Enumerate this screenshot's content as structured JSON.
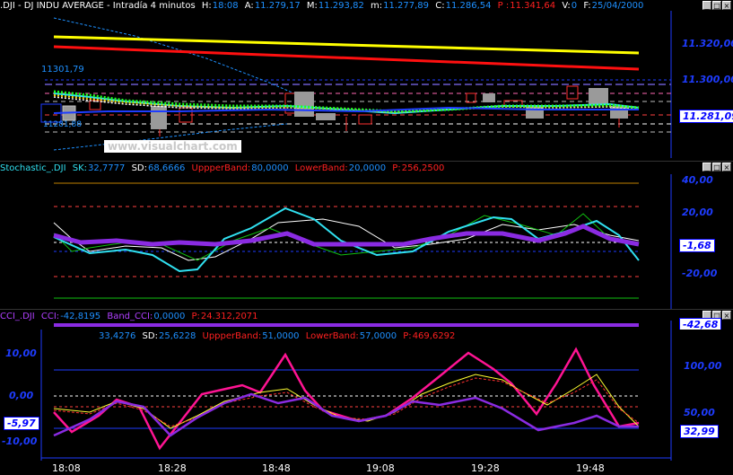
{
  "colors": {
    "axis": "#1e3cff",
    "yellow": "#ffff00",
    "red": "#ff1010",
    "cyan": "#30e0f0",
    "violet": "#8a2be2",
    "magenta": "#ff1493",
    "green": "#10c010",
    "white": "#ffffff",
    "grey": "#9a9a9a"
  },
  "price_pane": {
    "header": {
      "symbol": ".DJI - DJ INDU AVERAGE - Intradía 4 minutos",
      "h_label": "H:",
      "h_value": "18:08",
      "a_label": "A:",
      "a_value": "11.279,17",
      "m_label": "M:",
      "m_value": "11.293,82",
      "min_label": "m:",
      "min_value": "11.277,89",
      "c_label": "C:",
      "c_value": "11.286,54",
      "p_label": "P :",
      "p_value": "11.341,64",
      "v_label": "V:",
      "v_value": "0",
      "f_label": "F:",
      "f_value": "25/04/2000"
    },
    "axis_labels": [
      "11.320,00",
      "11.300,00"
    ],
    "current_value": "11.281,09",
    "level_label_top": "11301,79",
    "level_label_bottom": "11281,88",
    "watermark": "www.visualchart.com"
  },
  "stoch_pane": {
    "header": {
      "name": "Stochastic_.DJI",
      "sk_label": "SK:",
      "sk_value": "32,7777",
      "sd_label": "SD:",
      "sd_value": "68,6666",
      "upper_label": "UppperBand:",
      "upper_value": "80,0000",
      "lower_label": "LowerBand:",
      "lower_value": "20,0000",
      "p_label": "P:",
      "p_value": "256,2500"
    },
    "axis_labels": [
      "40,00",
      "20,00",
      "-20,00"
    ],
    "current_value": "-1,68"
  },
  "cci_pane": {
    "header": {
      "name": "CCI_.DJI",
      "cci_label": "CCI:",
      "cci_value": "-42,8195",
      "band_label": "Band_CCI:",
      "band_value": "0,0000",
      "p_label": "P:",
      "p_value": "24.312,2071"
    },
    "current_value": "-42,68"
  },
  "stoch2_pane": {
    "header": {
      "sk_value": "33,4276",
      "sd_label": "SD:",
      "sd_value": "25,6228",
      "upper_label": "UppperBand:",
      "upper_value": "51,0000",
      "lower_label": "LowerBand:",
      "lower_value": "57,0000",
      "p_label": "P:",
      "p_value": "469,6292"
    },
    "left_axis_labels": [
      "10,00",
      "0,00",
      "-10,00"
    ],
    "right_axis_labels": [
      "100,00",
      "50,00"
    ],
    "left_current_value": "-5,97",
    "right_current_value": "32,99"
  },
  "time_axis": [
    "18:08",
    "18:28",
    "18:48",
    "19:08",
    "19:28",
    "19:48"
  ]
}
